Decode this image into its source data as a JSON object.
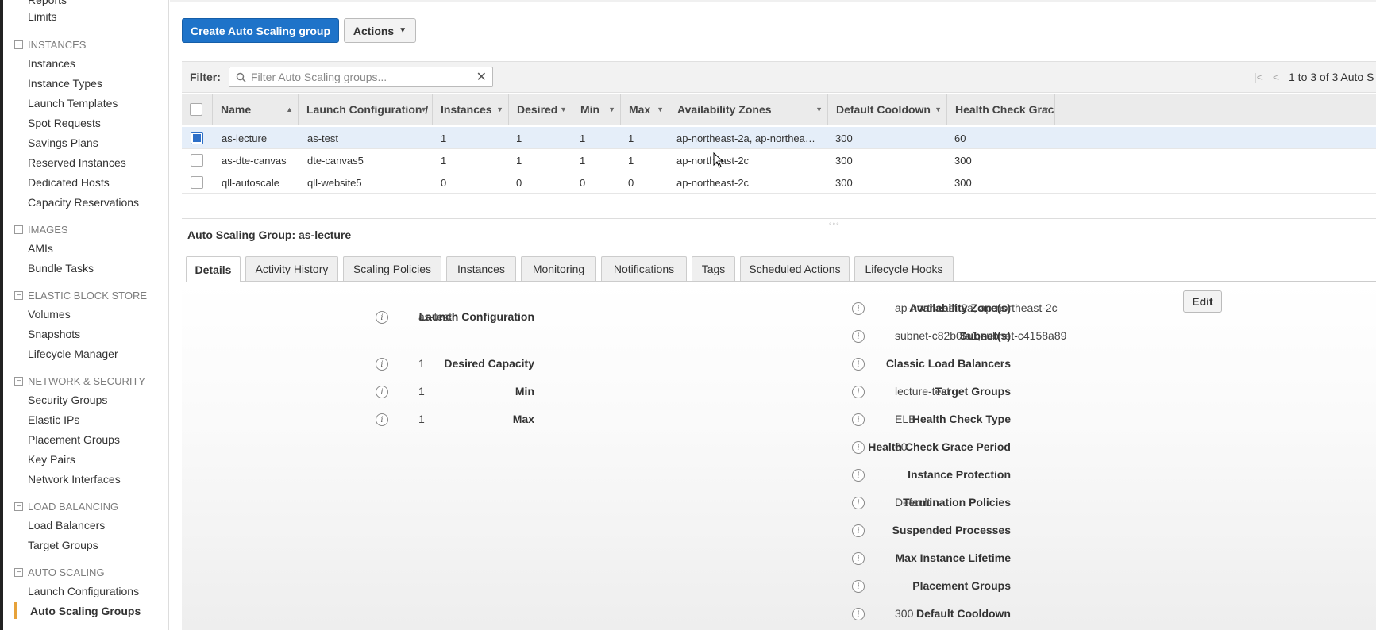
{
  "sidebar": {
    "top_items": [
      "Reports",
      "Limits"
    ],
    "sections": [
      {
        "title": "INSTANCES",
        "items": [
          "Instances",
          "Instance Types",
          "Launch Templates",
          "Spot Requests",
          "Savings Plans",
          "Reserved Instances",
          "Dedicated Hosts",
          "Capacity Reservations"
        ]
      },
      {
        "title": "IMAGES",
        "items": [
          "AMIs",
          "Bundle Tasks"
        ]
      },
      {
        "title": "ELASTIC BLOCK STORE",
        "items": [
          "Volumes",
          "Snapshots",
          "Lifecycle Manager"
        ]
      },
      {
        "title": "NETWORK & SECURITY",
        "items": [
          "Security Groups",
          "Elastic IPs",
          "Placement Groups",
          "Key Pairs",
          "Network Interfaces"
        ]
      },
      {
        "title": "LOAD BALANCING",
        "items": [
          "Load Balancers",
          "Target Groups"
        ]
      },
      {
        "title": "AUTO SCALING",
        "items": [
          "Launch Configurations",
          "Auto Scaling Groups"
        ]
      }
    ],
    "active_item": "Auto Scaling Groups"
  },
  "toolbar": {
    "create_label": "Create Auto Scaling group",
    "actions_label": "Actions"
  },
  "filter": {
    "label": "Filter:",
    "placeholder": "Filter Auto Scaling groups...",
    "pager_text": "1 to 3 of 3 Auto S"
  },
  "table": {
    "columns": [
      "Name",
      "Launch Configuration /",
      "Instances",
      "Desired",
      "Min",
      "Max",
      "Availability Zones",
      "Default Cooldown",
      "Health Check Grac"
    ],
    "rows": [
      {
        "selected": true,
        "cells": [
          "as-lecture",
          "as-test",
          "1",
          "1",
          "1",
          "1",
          "ap-northeast-2a, ap-northea…",
          "300",
          "60"
        ]
      },
      {
        "selected": false,
        "cells": [
          "as-dte-canvas",
          "dte-canvas5",
          "1",
          "1",
          "1",
          "1",
          "ap-northeast-2c",
          "300",
          "300"
        ]
      },
      {
        "selected": false,
        "cells": [
          "qll-autoscale",
          "qll-website5",
          "0",
          "0",
          "0",
          "0",
          "ap-northeast-2c",
          "300",
          "300"
        ]
      }
    ]
  },
  "details": {
    "title": "Auto Scaling Group: as-lecture",
    "tabs": [
      "Details",
      "Activity History",
      "Scaling Policies",
      "Instances",
      "Monitoring",
      "Notifications",
      "Tags",
      "Scheduled Actions",
      "Lifecycle Hooks"
    ],
    "active_tab": "Details",
    "edit_label": "Edit",
    "left_fields": [
      {
        "label": "Launch Configuration",
        "value": "as-test"
      },
      {
        "label": "Desired Capacity",
        "value": "1"
      },
      {
        "label": "Min",
        "value": "1"
      },
      {
        "label": "Max",
        "value": "1"
      }
    ],
    "right_fields": [
      {
        "label": "Availability Zone(s)",
        "value": "ap-northeast-2a, ap-northeast-2c"
      },
      {
        "label": "Subnet(s)",
        "value": "subnet-c82b0fa1,subnet-c4158a89"
      },
      {
        "label": "Classic Load Balancers",
        "value": ""
      },
      {
        "label": "Target Groups",
        "value": "lecture-test"
      },
      {
        "label": "Health Check Type",
        "value": "ELB"
      },
      {
        "label": "Health Check Grace Period",
        "value": "60"
      },
      {
        "label": "Instance Protection",
        "value": ""
      },
      {
        "label": "Termination Policies",
        "value": "Default"
      },
      {
        "label": "Suspended Processes",
        "value": ""
      },
      {
        "label": "Max Instance Lifetime",
        "value": ""
      },
      {
        "label": "Placement Groups",
        "value": ""
      },
      {
        "label": "Default Cooldown",
        "value": "300"
      }
    ]
  },
  "colors": {
    "primary_button": "#1e73c9",
    "active_nav_bar": "#e7a23a",
    "selected_row": "#e5eef9"
  }
}
